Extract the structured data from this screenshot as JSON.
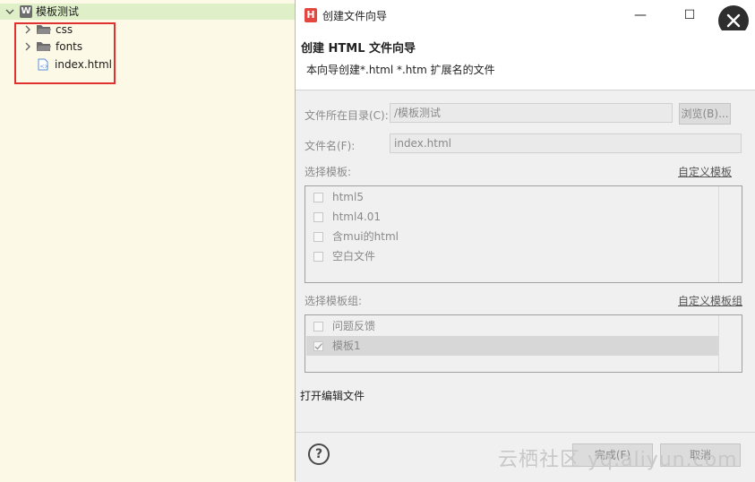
{
  "tree": {
    "root": {
      "label": "模板测试",
      "icon": "w-icon"
    },
    "items": [
      {
        "label": "css",
        "icon": "folder-icon"
      },
      {
        "label": "fonts",
        "icon": "folder-icon"
      },
      {
        "label": "index.html",
        "icon": "html-file-icon"
      }
    ]
  },
  "dialog": {
    "title": "创建文件向导",
    "app_icon": "H",
    "minimize": "—",
    "maximize": "☐",
    "close": "✕",
    "header_title": "创建 HTML 文件向导",
    "header_desc": "本向导创建*.html *.htm 扩展名的文件",
    "dir_label": "文件所在目录(C):",
    "dir_value": "/模板测试",
    "browse_label": "浏览(B)...",
    "filename_label": "文件名(F):",
    "filename_value": "index.html",
    "template_label": "选择模板:",
    "custom_template_link": "自定义模板",
    "templates": [
      "html5",
      "html4.01",
      "含mui的html",
      "空白文件"
    ],
    "group_label": "选择模板组:",
    "custom_group_link": "自定义模板组",
    "groups": [
      {
        "label": "问题反馈",
        "checked": false
      },
      {
        "label": "模板1",
        "checked": true
      }
    ],
    "open_editor": "打开编辑文件",
    "help": "?",
    "finish_label": "完成(F)",
    "cancel_label": "取消",
    "watermark": "云栖社区 yq.aliyun.com"
  }
}
